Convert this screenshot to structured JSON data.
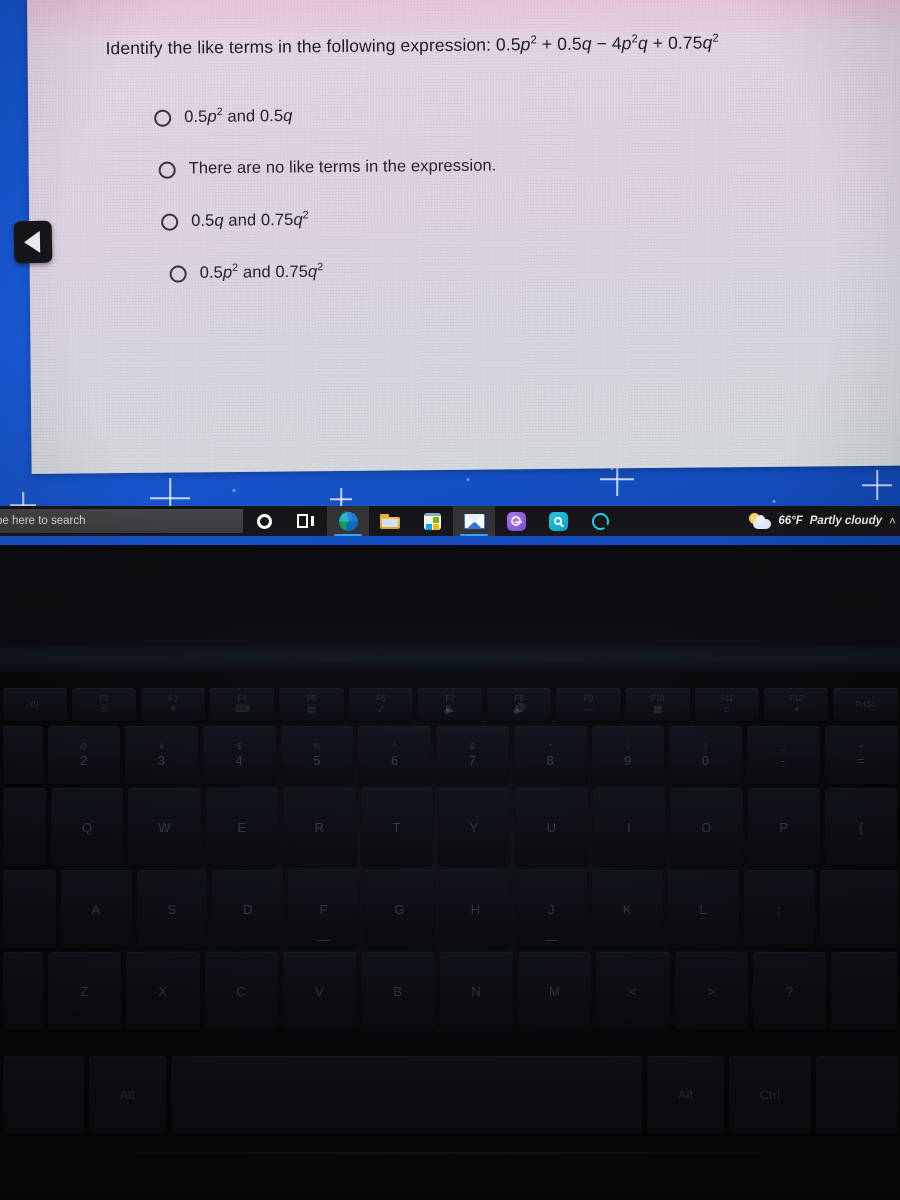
{
  "quiz": {
    "question_prefix": "Identify the like terms in the following expression:",
    "expression": "0.5p² + 0.5q − 4p²q + 0.75q²",
    "options": [
      {
        "id": "opt-a",
        "label": "0.5p² and 0.5q",
        "selected": false
      },
      {
        "id": "opt-b",
        "label": "There are no like terms in the expression.",
        "selected": false
      },
      {
        "id": "opt-c",
        "label": "0.5q and 0.75q²",
        "selected": false
      },
      {
        "id": "opt-d",
        "label": "0.5p² and 0.75q²",
        "selected": false
      }
    ]
  },
  "nav": {
    "back_icon": "back-triangle-icon"
  },
  "taskbar": {
    "search_placeholder": "pe here to search",
    "icons": [
      {
        "name": "cortana-icon",
        "label": "Cortana",
        "active": false
      },
      {
        "name": "task-view-icon",
        "label": "Task View",
        "active": false
      },
      {
        "name": "edge-icon",
        "label": "Microsoft Edge",
        "active": true
      },
      {
        "name": "file-explorer-icon",
        "label": "File Explorer",
        "active": false
      },
      {
        "name": "microsoft-store-icon",
        "label": "Microsoft Store",
        "active": false
      },
      {
        "name": "mail-icon",
        "label": "Mail",
        "active": true
      },
      {
        "name": "purple-app-icon",
        "label": "App",
        "active": false
      },
      {
        "name": "teal-search-icon",
        "label": "Search App",
        "active": false
      },
      {
        "name": "alexa-icon",
        "label": "Alexa",
        "active": false
      }
    ],
    "weather": {
      "temperature": "66°F",
      "condition": "Partly cloudy",
      "icon": "sun-behind-cloud-icon"
    },
    "tray_chevron": "˄"
  },
  "keyboard": {
    "fn_row": [
      {
        "fn": "",
        "glyph": "⏻"
      },
      {
        "fn": "F2",
        "glyph": "☉"
      },
      {
        "fn": "F3",
        "glyph": "☀"
      },
      {
        "fn": "F4",
        "glyph": "⌨"
      },
      {
        "fn": "F5",
        "glyph": "▤"
      },
      {
        "fn": "F6",
        "glyph": "⤦"
      },
      {
        "fn": "F7",
        "glyph": "🔈"
      },
      {
        "fn": "F8",
        "glyph": "🔊"
      },
      {
        "fn": "F9",
        "glyph": "—"
      },
      {
        "fn": "F10",
        "glyph": "▦"
      },
      {
        "fn": "F11",
        "glyph": "⌂"
      },
      {
        "fn": "F12",
        "glyph": "◑"
      },
      {
        "fn": "PrtSc",
        "glyph": ""
      }
    ],
    "num_row": [
      {
        "top": "",
        "bottom": ""
      },
      {
        "top": "@",
        "bottom": "2"
      },
      {
        "top": "#",
        "bottom": "3"
      },
      {
        "top": "$",
        "bottom": "4"
      },
      {
        "top": "%",
        "bottom": "5"
      },
      {
        "top": "^",
        "bottom": "6"
      },
      {
        "top": "&",
        "bottom": "7"
      },
      {
        "top": "*",
        "bottom": "8"
      },
      {
        "top": "(",
        "bottom": "9"
      },
      {
        "top": ")",
        "bottom": "0"
      },
      {
        "top": "_",
        "bottom": "-"
      },
      {
        "top": "+",
        "bottom": "="
      }
    ],
    "q_row": [
      "Q",
      "W",
      "E",
      "R",
      "T",
      "Y",
      "U",
      "I",
      "O",
      "P",
      "{"
    ],
    "a_row": [
      "A",
      "S",
      "D",
      "F",
      "G",
      "H",
      "J",
      "K",
      "L",
      ":"
    ],
    "z_row": [
      "Z",
      "X",
      "C",
      "V",
      "B",
      "N",
      "M",
      "<",
      ">",
      "?"
    ],
    "space_row": [
      "",
      "Alt",
      "",
      "Alt",
      "Ctrl",
      ""
    ]
  }
}
